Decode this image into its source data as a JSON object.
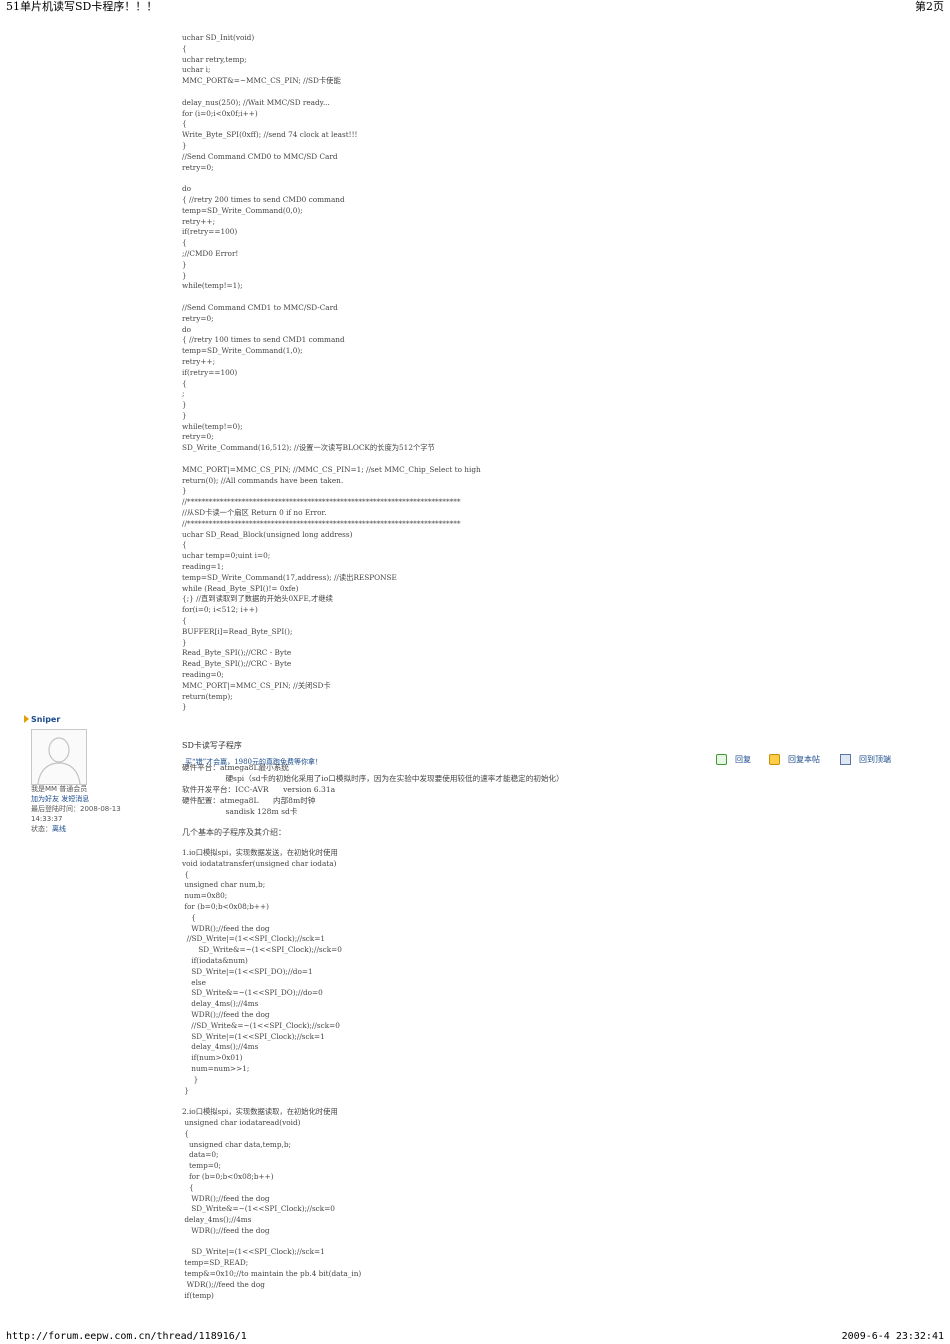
{
  "header": {
    "title": "51单片机读写SD卡程序！！！",
    "page": "第2页"
  },
  "footer": {
    "url": "http://forum.eepw.com.cn/thread/118916/1",
    "datetime": "2009-6-4 23:32:41"
  },
  "code_block_1": "uchar SD_Init(void)\n{\nuchar retry,temp;\nuchar i;\nMMC_PORT&=~MMC_CS_PIN; //SD卡使能\n\ndelay_nus(250); //Wait MMC/SD ready...\nfor (i=0;i<0x0f;i++)\n{\nWrite_Byte_SPI(0xff); //send 74 clock at least!!!\n}\n//Send Command CMD0 to MMC/SD Card\nretry=0;\n\ndo\n{ //retry 200 times to send CMD0 command\ntemp=SD_Write_Command(0,0);\nretry++;\nif(retry==100)\n{\n;//CMD0 Error!\n}\n}\nwhile(temp!=1);\n\n//Send Command CMD1 to MMC/SD-Card\nretry=0;\ndo\n{ //retry 100 times to send CMD1 command\ntemp=SD_Write_Command(1,0);\nretry++;\nif(retry==100)\n{\n;\n}\n}\nwhile(temp!=0);\nretry=0;\nSD_Write_Command(16,512); //设置一次读写BLOCK的长度为512个字节\n\nMMC_PORT|=MMC_CS_PIN; //MMC_CS_PIN=1; //set MMC_Chip_Select to high\nreturn(0); //All commands have been taken.\n}\n//***************************************************************************\n//从SD卡读一个扇区 Return 0 if no Error.\n//***************************************************************************\nuchar SD_Read_Block(unsigned long address)\n{\nuchar temp=0;uint i=0;\nreading=1;\ntemp=SD_Write_Command(17,address); //读出RESPONSE\nwhile (Read_Byte_SPI()!= 0xfe)\n{;} //直到读取到了数据的开始头0XFE,才继续\nfor(i=0; i<512; i++)\n{\nBUFFER[i]=Read_Byte_SPI();\n}\nRead_Byte_SPI();//CRC - Byte\nRead_Byte_SPI();//CRC - Byte\nreading=0;\nMMC_PORT|=MMC_CS_PIN; //关闭SD卡\nreturn(temp);\n}",
  "author": {
    "name": "Sniper",
    "rank_line": "我是MM  普通会员",
    "links": "加为好友 发短消息",
    "last_login": "最后登陆时间：2008-08-13",
    "last_login_time": "14:33:37",
    "status_label": "状态：",
    "status_value": "离线"
  },
  "post": {
    "title": "SD卡读写子程序",
    "ad": "买“错”才会赢，1980元的真跑免费等你拿！",
    "meta": "硬件平台：atmega8L最小系统\n                  硬spi（sd卡的初始化采用了io口模拟时序，因为在实验中发现要使用较低的速率才能稳定的初始化）\n软件开发平台：ICC-AVR      version 6.31a\n硬件配置：atmega8L      内部8m时钟\n                  sandisk 128m sd卡",
    "intro": "几个基本的子程序及其介绍："
  },
  "actions": {
    "reply": "回复",
    "reply_quote": "回复本帖",
    "back_top": "回到顶端"
  },
  "code_block_2": "1.io口模拟spi，实现数据发送，在初始化时使用\nvoid iodatatransfer(unsigned char iodata)\n {\n unsigned char num,b;\n num=0x80;\n for (b=0;b<0x08;b++)\n    {\n    WDR();//feed the dog\n  //SD_Write|=(1<<SPI_Clock);//sck=1\n       SD_Write&=~(1<<SPI_Clock);//sck=0\n    if(iodata&num)\n    SD_Write|=(1<<SPI_DO);//do=1\n    else\n    SD_Write&=~(1<<SPI_DO);//do=0\n    delay_4ms();//4ms\n    WDR();//feed the dog\n    //SD_Write&=~(1<<SPI_Clock);//sck=0\n    SD_Write|=(1<<SPI_Clock);//sck=1\n    delay_4ms();//4ms\n    if(num>0x01)\n    num=num>>1;\n     }\n }\n\n2.io口模拟spi，实现数据读取，在初始化时使用\n unsigned char iodataread(void)\n {\n   unsigned char data,temp,b;\n   data=0;\n   temp=0;\n   for (b=0;b<0x08;b++)\n   {\n    WDR();//feed the dog\n    SD_Write&=~(1<<SPI_Clock);//sck=0\n delay_4ms();//4ms\n    WDR();//feed the dog\n\n    SD_Write|=(1<<SPI_Clock);//sck=1\n temp=SD_READ;\n temp&=0x10;//to maintain the pb.4 bit(data_in)\n  WDR();//feed the dog\n if(temp)"
}
